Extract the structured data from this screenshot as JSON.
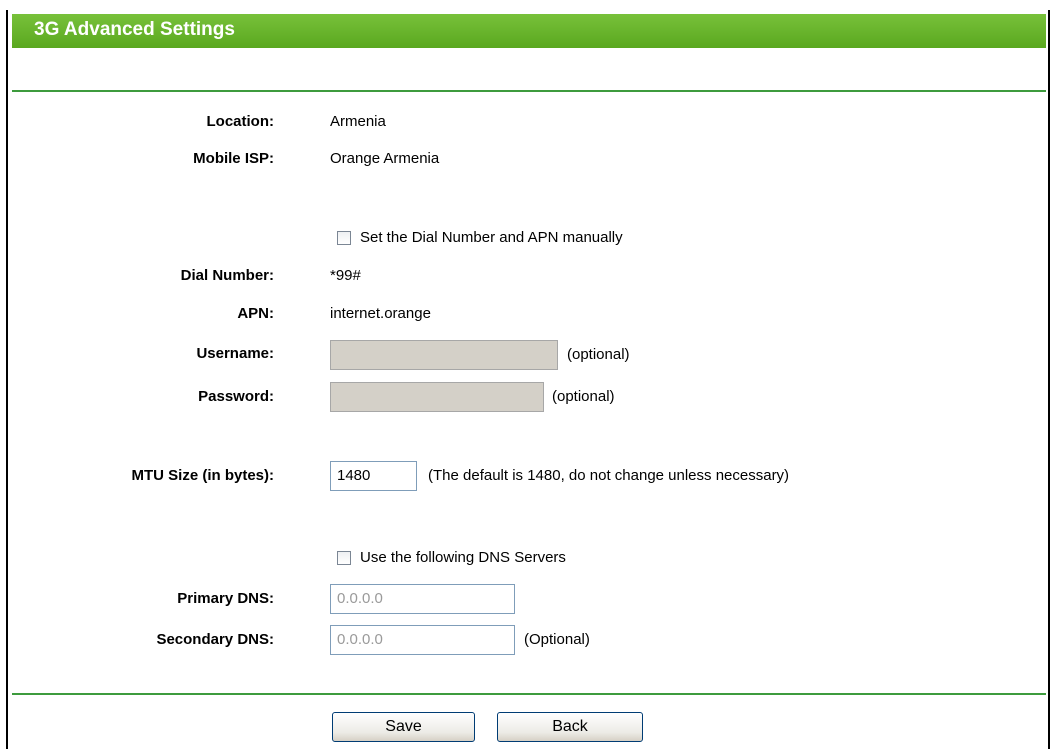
{
  "header": {
    "title": "3G Advanced Settings"
  },
  "fields": {
    "location_label": "Location:",
    "location_value": "Armenia",
    "isp_label": "Mobile ISP:",
    "isp_value": "Orange Armenia",
    "manual_checkbox_label": "Set the Dial Number and APN manually",
    "dial_label": "Dial Number:",
    "dial_value": "*99#",
    "apn_label": "APN:",
    "apn_value": "internet.orange",
    "username_label": "Username:",
    "username_note": "(optional)",
    "password_label": "Password:",
    "password_note": "(optional)",
    "mtu_label": "MTU Size (in bytes):",
    "mtu_value": "1480",
    "mtu_note": "(The default is 1480, do not change unless necessary)",
    "dns_checkbox_label": "Use the following DNS Servers",
    "primary_dns_label": "Primary DNS:",
    "primary_dns_value": "0.0.0.0",
    "secondary_dns_label": "Secondary DNS:",
    "secondary_dns_value": "0.0.0.0",
    "secondary_dns_note": "(Optional)"
  },
  "buttons": {
    "save": "Save",
    "back": "Back"
  }
}
